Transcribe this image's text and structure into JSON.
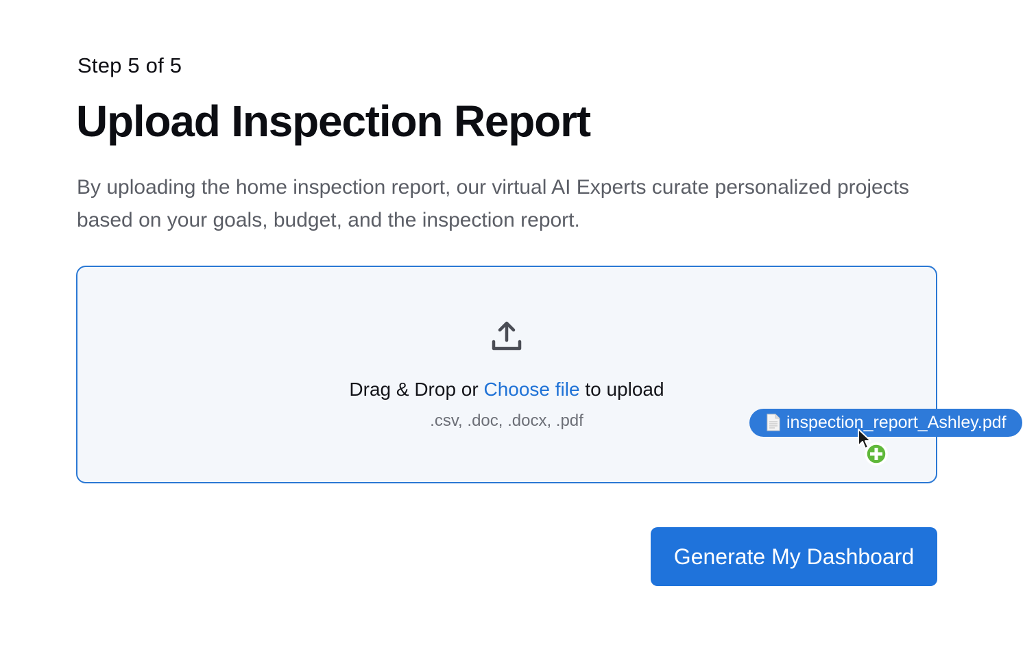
{
  "step": {
    "label": "Step 5 of 5"
  },
  "header": {
    "title": "Upload Inspection Report"
  },
  "description": "By uploading the home inspection report, our virtual AI Experts curate personalized projects based on your goals, budget, and the inspection report.",
  "dropzone": {
    "icon": "upload-icon",
    "text_before": "Drag & Drop or ",
    "link_label": "Choose file",
    "text_after": " to upload",
    "formats": ".csv, .doc, .docx, .pdf"
  },
  "dragged_file": {
    "icon": "document-icon",
    "name": "inspection_report_Ashley.pdf",
    "badge_icon": "plus-circle-icon"
  },
  "actions": {
    "generate_label": "Generate My Dashboard"
  },
  "colors": {
    "accent": "#1f73db",
    "link": "#1f72d6",
    "dropzone_border": "#2a78d4",
    "dropzone_bg": "#f4f7fb",
    "badge_green": "#5fb83a"
  }
}
